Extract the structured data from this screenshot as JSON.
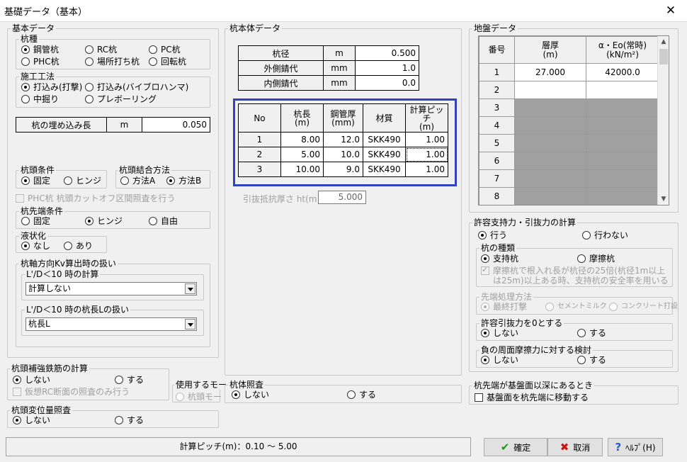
{
  "window": {
    "title": "基礎データ（基本）",
    "close": "✕"
  },
  "basic": {
    "title": "基本データ",
    "pile_type": {
      "title": "杭種",
      "options": [
        "鋼管杭",
        "RC杭",
        "PC杭",
        "PHC杭",
        "場所打ち杭",
        "回転杭"
      ],
      "selected": 0
    },
    "method": {
      "title": "施工工法",
      "options": [
        "打込み(打撃)",
        "打込み(バイブロハンマ)",
        "中掘り",
        "プレボーリング"
      ],
      "selected": 0
    },
    "embed": {
      "label": "杭の埋め込み長",
      "unit": "m",
      "value": "0.050"
    },
    "head_cond": {
      "title": "杭頭条件",
      "options": [
        "固定",
        "ヒンジ"
      ],
      "selected": 0
    },
    "head_join": {
      "title": "杭頭結合方法",
      "options": [
        "方法A",
        "方法B"
      ],
      "selected": 1
    },
    "phc_check": "PHC杭 杭頭カットオフ区間照査を行う",
    "tip_cond": {
      "title": "杭先端条件",
      "options": [
        "固定",
        "ヒンジ",
        "自由"
      ],
      "selected": 1
    },
    "liq": {
      "title": "液状化",
      "options": [
        "なし",
        "あり"
      ],
      "selected": 0
    },
    "kv": {
      "title": "杭軸方向Kv算出時の扱い",
      "calc": {
        "title": "L'/D＜10 時の計算",
        "value": "計算しない"
      },
      "len": {
        "title": "L'/D＜10 時の杭長Lの扱い",
        "value": "杭長L"
      }
    }
  },
  "rebar": {
    "title": "杭頭補強鉄筋の計算",
    "options": [
      "しない",
      "する"
    ],
    "selected": 0,
    "virtual": "仮想RC断面の照査のみ行う"
  },
  "use_mode": {
    "title": "使用するモー",
    "option": "杭頭モー"
  },
  "disp": {
    "title": "杭頭変位量照査",
    "options": [
      "しない",
      "する"
    ],
    "selected": 0
  },
  "body": {
    "title": "杭本体データ",
    "top": [
      {
        "label": "杭径",
        "unit": "m",
        "value": "0.500"
      },
      {
        "label": "外側錆代",
        "unit": "mm",
        "value": "1.0"
      },
      {
        "label": "内側錆代",
        "unit": "mm",
        "value": "0.0"
      }
    ],
    "headers": [
      "No",
      "杭長\n(m)",
      "鋼管厚\n(mm)",
      "材質",
      "計算ピッチ\n(m)"
    ],
    "rows": [
      [
        "1",
        "8.00",
        "12.0",
        "SKK490",
        "1.00"
      ],
      [
        "2",
        "5.00",
        "10.0",
        "SKK490",
        "1.00"
      ],
      [
        "3",
        "10.00",
        "9.0",
        "SKK490",
        "1.00"
      ]
    ],
    "pullout": {
      "label": "引抜抵抗厚さ ht(m)",
      "value": "5.000"
    }
  },
  "check": {
    "title": "杭体照査",
    "options": [
      "しない",
      "する"
    ],
    "selected": 0
  },
  "ground": {
    "title": "地盤データ",
    "headers": [
      "番号",
      "層厚\n(m)",
      "α・Eo(常時)\n(kN/m²)"
    ],
    "rows": [
      [
        "1",
        "27.000",
        "42000.0"
      ],
      [
        "2",
        "",
        ""
      ],
      [
        "3",
        "",
        ""
      ],
      [
        "4",
        "",
        ""
      ],
      [
        "5",
        "",
        ""
      ],
      [
        "6",
        "",
        ""
      ],
      [
        "7",
        "",
        ""
      ],
      [
        "8",
        "",
        ""
      ]
    ]
  },
  "allow": {
    "title": "許容支持力・引抜力の計算",
    "options": [
      "行う",
      "行わない"
    ],
    "selected": 0,
    "kind": {
      "title": "杭の種類",
      "options": [
        "支持杭",
        "摩擦杭"
      ],
      "selected": 0,
      "note": "摩擦杭で根入れ長が杭径の25倍(杭径1m以上は25m)以上ある時、支持杭の安全率を用いる"
    },
    "tip": {
      "title": "先端処理方法",
      "options": [
        "最終打撃",
        "セメントミルク",
        "コンクリート打設"
      ],
      "selected": 0
    },
    "pull0": {
      "title": "許容引抜力を0とする",
      "options": [
        "しない",
        "する"
      ],
      "selected": 0
    },
    "neg": {
      "title": "負の周面摩擦力に対する検討",
      "options": [
        "しない",
        "する"
      ],
      "selected": 0
    }
  },
  "deep": {
    "title": "杭先端が基盤面以深にあるとき",
    "check": "基盤面を杭先端に移動する"
  },
  "status": "計算ピッチ(m)：0.10 〜 5.00",
  "buttons": {
    "ok": "確定",
    "cancel": "取消",
    "help": "ﾍﾙﾌﾟ(H)"
  },
  "colors": {
    "highlight": "#3344bb",
    "grid_shade": "#a0a0a0"
  }
}
